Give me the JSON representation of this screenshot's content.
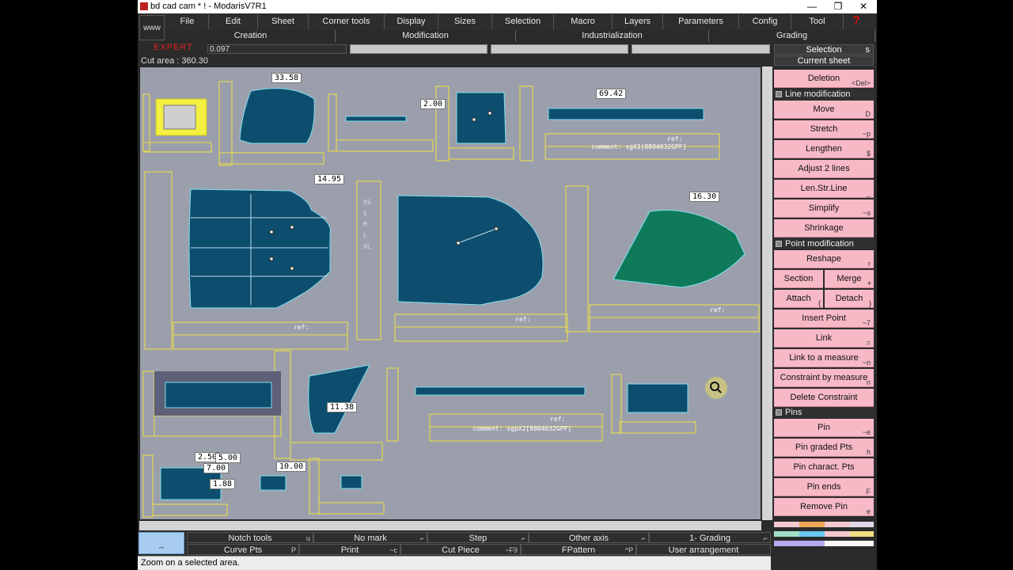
{
  "window": {
    "title": "bd cad cam * ! - ModarisV7R1",
    "minimize": "—",
    "maximize": "❐",
    "close": "✕"
  },
  "toolbar": {
    "www": "www",
    "help_icon": "?"
  },
  "menu": [
    "File",
    "Edit",
    "Sheet",
    "Corner tools",
    "Display",
    "Sizes",
    "Selection",
    "Macro",
    "Layers",
    "Parameters",
    "Config",
    "Tool"
  ],
  "submenu": [
    "Creation",
    "Modification",
    "Industrialization",
    "Grading"
  ],
  "mode": {
    "label": "EXPERT",
    "value": "0.097"
  },
  "cut_area": "Cut area : 360.30",
  "canvas": {
    "labels": [
      "33.58",
      "2.00",
      "69.42",
      "14.95",
      "16.30",
      "11.38",
      "10.00",
      "2.50",
      "5.00",
      "7.00",
      "1.88"
    ],
    "ref_text": "ref:",
    "comment_1": "comment: sgX1[8804032GPF]",
    "comment_2": "comment: sgpX2[8804032GPF]",
    "sizes": [
      "XS",
      "S",
      "M",
      "L",
      "XL"
    ]
  },
  "right_panel": {
    "selection": "Selection",
    "selection_shortcut": "s",
    "current_sheet": "Current sheet",
    "deletion": {
      "label": "Deletion",
      "shortcut": "<Del>"
    },
    "line_modification": "Line modification",
    "line_tools": [
      {
        "label": "Move",
        "shortcut": "D"
      },
      {
        "label": "Stretch",
        "shortcut": "~p"
      },
      {
        "label": "Lengthen",
        "shortcut": "$"
      },
      {
        "label": "Adjust 2 lines",
        "shortcut": ""
      },
      {
        "label": "Len.Str.Line",
        "shortcut": "_"
      },
      {
        "label": "Simplify",
        "shortcut": "~s"
      },
      {
        "label": "Shrinkage",
        "shortcut": ""
      }
    ],
    "point_modification": "Point modification",
    "reshape": {
      "label": "Reshape",
      "shortcut": "r"
    },
    "section": "Section",
    "merge": {
      "label": "Merge",
      "shortcut": "+"
    },
    "attach": {
      "label": "Attach",
      "shortcut": "("
    },
    "detach": {
      "label": "Detach",
      "shortcut": ")"
    },
    "point_tools": [
      {
        "label": "Insert Point",
        "shortcut": "~7"
      },
      {
        "label": "Link",
        "shortcut": "="
      },
      {
        "label": "Link to a measure",
        "shortcut": "~n"
      },
      {
        "label": "Constraint by measure",
        "shortcut": "n"
      },
      {
        "label": "Delete Constraint",
        "shortcut": ""
      }
    ],
    "pins": "Pins",
    "pin_tools": [
      {
        "label": "Pin",
        "shortcut": "~e"
      },
      {
        "label": "Pin graded Pts",
        "shortcut": "h"
      },
      {
        "label": "Pin charact. Pts",
        "shortcut": ""
      },
      {
        "label": "Pin ends",
        "shortcut": "F"
      },
      {
        "label": "Remove Pin",
        "shortcut": "e"
      }
    ]
  },
  "bottom": {
    "row1": [
      {
        "label": "Notch tools",
        "shortcut": "u"
      },
      {
        "label": "No mark",
        "shortcut": "⌐"
      },
      {
        "label": "Step",
        "shortcut": "⌐"
      },
      {
        "label": "Other axis",
        "shortcut": "⌐"
      },
      {
        "label": "1- Grading",
        "shortcut": "⌐"
      }
    ],
    "row2": [
      {
        "label": "Curve Pts",
        "shortcut": "P"
      },
      {
        "label": "Print",
        "shortcut": "~c"
      },
      {
        "label": "Cut Piece",
        "shortcut": "~F9"
      },
      {
        "label": "FPattern",
        "shortcut": "^P"
      },
      {
        "label": "User arrangement",
        "shortcut": ""
      }
    ],
    "blue_box": "_"
  },
  "status": "Zoom on a selected area.",
  "colors": {
    "piece": "#0d4d6d",
    "piece_selected": "#0e7a5a",
    "canvas": "#9b9fac",
    "button": "#f7b9c6",
    "yellow_line": "#f0e040"
  }
}
